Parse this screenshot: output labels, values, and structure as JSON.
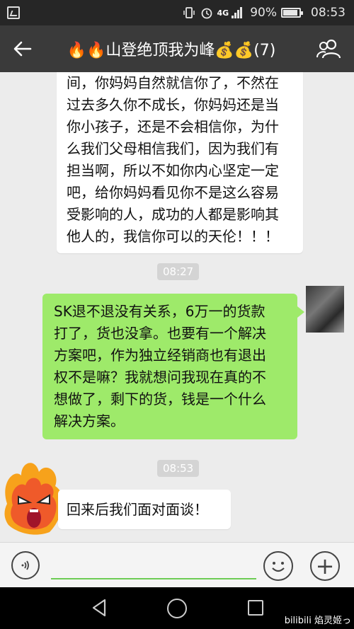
{
  "status_bar": {
    "network": "4G",
    "battery": "90%",
    "time": "08:53"
  },
  "header": {
    "title": "🔥🔥山登绝顶我为峰💰💰(7)"
  },
  "messages": {
    "msg1_lines": [
      "间，你妈妈自然就信你了，不然在",
      "过去多久你不成长，你妈妈还是当",
      "你小孩子，还是不会相信你，为什",
      "么我们父母相信我们，因为我们有",
      "担当啊，所以不如你内心坚定一定",
      "吧，给你妈妈看见你不是这么容易",
      "受影响的人，成功的人都是影响其",
      "他人的，我信你可以的天伦！！！"
    ],
    "time1": "08:27",
    "msg2_lines": [
      "SK退不退没有关系，6万一的货款",
      "打了，货也没拿。也要有一个解决",
      "方案吧，作为独立经销商也有退出",
      "权不是嘛？我就想问我现在真的不",
      "想做了，剩下的货，钱是一个什么",
      "解决方案。"
    ],
    "time2": "08:53",
    "msg3": "回来后我们面对面谈！"
  },
  "watermark": "bilibili 焰灵姬っ",
  "icons": [
    "image-icon",
    "signal-icon",
    "battery-icon",
    "back-arrow-icon",
    "group-icon",
    "voice-icon",
    "emoji-icon",
    "plus-icon",
    "nav-back-icon",
    "nav-home-icon",
    "nav-recent-icon"
  ],
  "colors": {
    "green_bubble": "#9eea6a",
    "title_bar": "#3a3a3a",
    "chat_bg": "#ececec"
  }
}
